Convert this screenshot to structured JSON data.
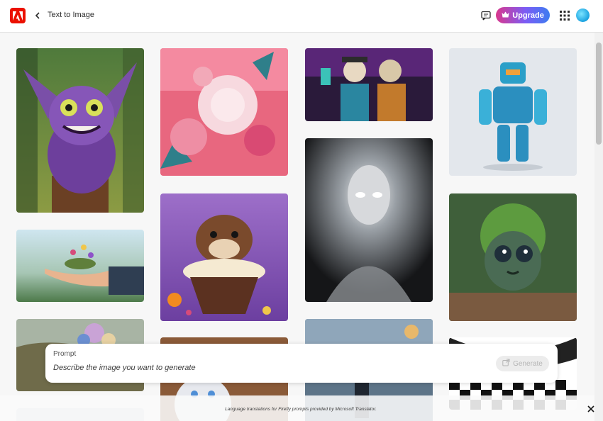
{
  "header": {
    "logo": "adobe-logo-icon",
    "back": "chevron-left-icon",
    "title": "Text to Image",
    "chat_icon": "message-icon",
    "upgrade_label": "Upgrade",
    "upgrade_icon": "crown-icon",
    "apps_icon": "app-grid-icon"
  },
  "gallery": {
    "items": [
      {
        "subject": "purple furry creature on stump",
        "name": "gallery-image-creature"
      },
      {
        "subject": "pink paper flowers",
        "name": "gallery-image-flowers"
      },
      {
        "subject": "skeletons taking selfie",
        "name": "gallery-image-skeletons"
      },
      {
        "subject": "blue robot",
        "name": "gallery-image-robot"
      },
      {
        "subject": "hand holding flowers",
        "name": "gallery-image-hand"
      },
      {
        "subject": "otter in cupcake",
        "name": "gallery-image-otter"
      },
      {
        "subject": "glowing silver figure",
        "name": "gallery-image-glowing-figure"
      },
      {
        "subject": "green leafy monster",
        "name": "gallery-image-leafy-monster"
      }
    ]
  },
  "prompt": {
    "label": "Prompt",
    "placeholder": "Describe the image you want to generate",
    "generate_label": "Generate"
  },
  "footer": {
    "note": "Language translations for Firefly prompts provided by Microsoft Translator.",
    "close_icon": "close-icon"
  },
  "colors": {
    "brand": "#eb1000",
    "upgrade_gradient": [
      "#d9388d",
      "#7b5cf5",
      "#3d7cf0"
    ]
  }
}
